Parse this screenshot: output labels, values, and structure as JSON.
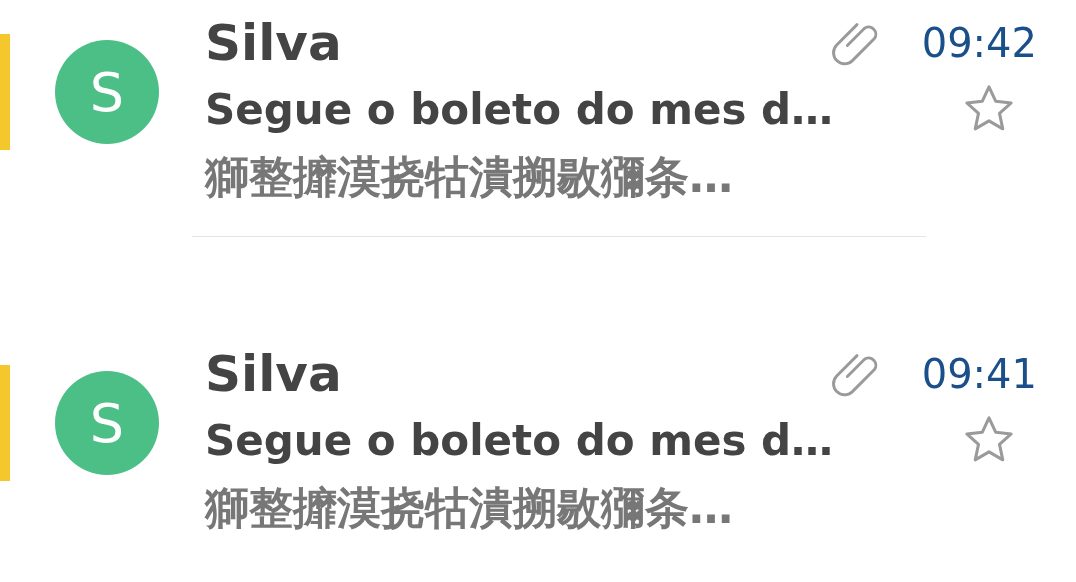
{
  "messages": [
    {
      "avatar_letter": "S",
      "sender": "Silva",
      "subject": "Segue o boleto do mes d…",
      "preview": "獅整攠漠挠牯潰搠敭獼条…",
      "time": "09:42",
      "unread": true,
      "has_attachment": true,
      "starred": false
    },
    {
      "avatar_letter": "S",
      "sender": "Silva",
      "subject": "Segue o boleto do mes d…",
      "preview": "獅整攠漠挠牯潰搠敭獼条…",
      "time": "09:41",
      "unread": true,
      "has_attachment": true,
      "starred": false
    }
  ]
}
